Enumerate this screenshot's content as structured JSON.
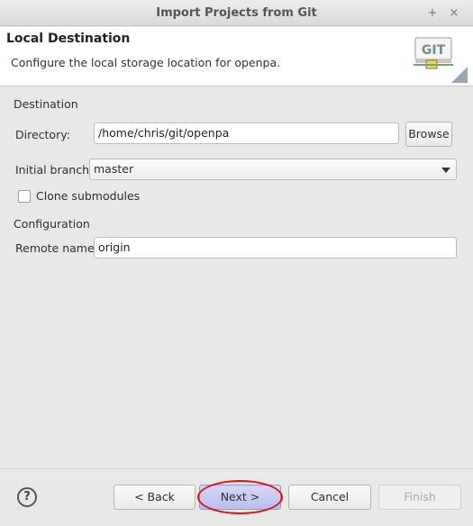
{
  "window": {
    "title": "Import Projects from Git",
    "controls": [
      "+",
      "×"
    ]
  },
  "header": {
    "title": "Local Destination",
    "description": "Configure the local storage location for openpa.",
    "logo_text": "GIT"
  },
  "destination": {
    "group_label": "Destination",
    "directory_label": "Directory:",
    "directory_value": "/home/chris/git/openpa",
    "browse_label": "Browse",
    "branch_label": "Initial branch:",
    "branch_value": "master",
    "clone_submodules_label": "Clone submodules",
    "clone_submodules_checked": false
  },
  "configuration": {
    "group_label": "Configuration",
    "remote_name_label": "Remote name:",
    "remote_name_value": "origin"
  },
  "footer": {
    "help_glyph": "?",
    "back_label": "< Back",
    "next_label": "Next >",
    "cancel_label": "Cancel",
    "finish_label": "Finish"
  },
  "colors": {
    "primary_button": "#b9bdf0",
    "highlight": "#e01010"
  }
}
